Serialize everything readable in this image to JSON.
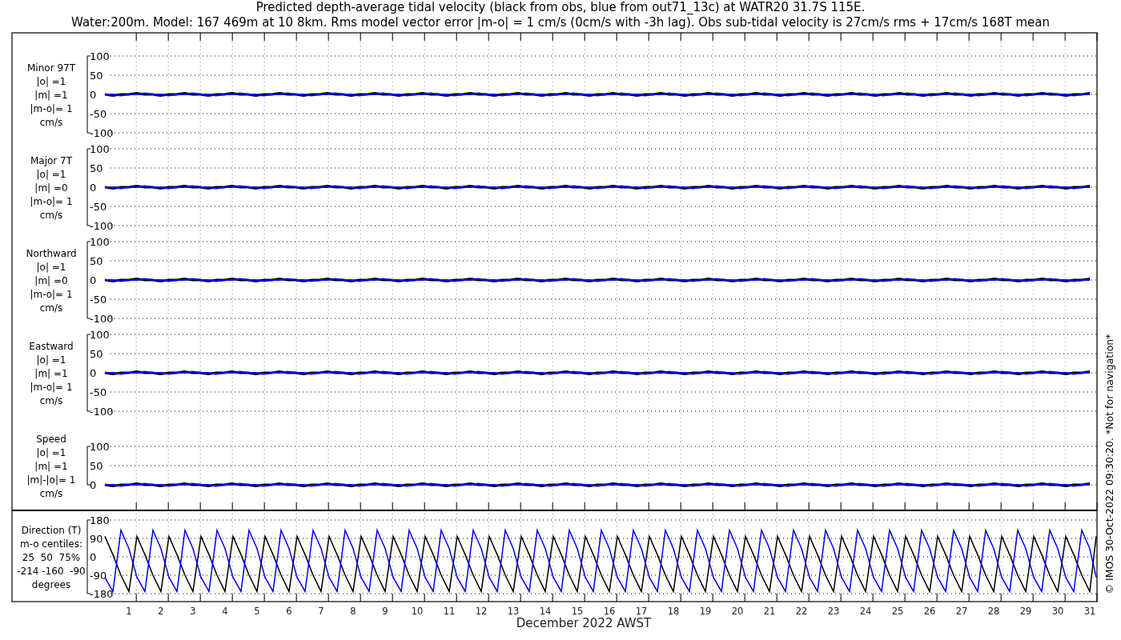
{
  "title_lines": [
    "Predicted depth-average tidal velocity (black from obs, blue from out71_13c) at WATR20 31.7S 115E.",
    "Water:200m. Model: 167 469m at 10 8km. Rms model vector error |m-o| = 1 cm/s (0cm/s with -3h lag). Obs sub-tidal velocity is 27cm/s rms + 17cm/s 168T mean"
  ],
  "panels": [
    {
      "kind": "velocity",
      "label_lines": [
        "Minor 97T",
        "|o| =1",
        "|m| =1",
        "|m-o|= 1",
        "cm/s"
      ],
      "y_ticks": [
        "100",
        "50",
        "0",
        "-50",
        "-100"
      ]
    },
    {
      "kind": "velocity",
      "label_lines": [
        "Major 7T",
        "|o| =1",
        "|m| =0",
        "|m-o|= 1",
        "cm/s"
      ],
      "y_ticks": [
        "100",
        "50",
        "0",
        "-50",
        "-100"
      ]
    },
    {
      "kind": "velocity",
      "label_lines": [
        "Northward",
        "|o| =1",
        "|m| =0",
        "|m-o|= 1",
        "cm/s"
      ],
      "y_ticks": [
        "100",
        "50",
        "0",
        "-50",
        "-100"
      ]
    },
    {
      "kind": "velocity",
      "label_lines": [
        "Eastward",
        "|o| =1",
        "|m| =1",
        "|m-o|= 1",
        "cm/s"
      ],
      "y_ticks": [
        "100",
        "50",
        "0",
        "-50",
        "-100"
      ]
    },
    {
      "kind": "velocity",
      "label_lines": [
        "Speed",
        "|o| =1",
        "|m| =1",
        "|m|-|o|= 1",
        "cm/s"
      ],
      "y_ticks": [
        "100",
        "50",
        "0"
      ]
    },
    {
      "kind": "direction",
      "label_lines": [
        "Direction (T)",
        "m-o centiles:",
        "25  50  75%",
        "-214 -160  -90",
        "degrees"
      ],
      "chart_data": {
        "type": "line",
        "xlabel": "December 2022 AWST",
        "xlim": [
          -2.65,
          31.22
        ],
        "grid": true,
        "ylim": [
          -180,
          180
        ],
        "yticks": [
          -180,
          -90,
          0,
          90,
          180
        ],
        "xticks": [
          1,
          2,
          3,
          4,
          5,
          6,
          7,
          8,
          9,
          10,
          11,
          12,
          13,
          14,
          15,
          16,
          17,
          18,
          19,
          20,
          21,
          22,
          23,
          24,
          25,
          26,
          27,
          28,
          29,
          30,
          31
        ],
        "x": [
          0.25,
          0.5,
          0.75,
          1,
          1.25,
          1.5,
          1.75,
          2,
          2.25,
          2.5,
          2.75,
          3,
          3.25,
          3.5,
          3.75,
          4,
          4.25,
          4.5,
          4.75,
          5,
          5.25,
          5.5,
          5.75,
          6,
          6.25,
          6.5,
          6.75,
          7,
          7.25,
          7.5,
          7.75,
          8,
          8.25,
          8.5,
          8.75,
          9,
          9.25,
          9.5,
          9.75,
          10,
          10.25,
          10.5,
          10.75,
          11,
          11.25,
          11.5,
          11.75,
          12,
          12.25,
          12.5,
          12.75,
          13,
          13.25,
          13.5,
          13.75,
          14,
          14.25,
          14.5,
          14.75,
          15,
          15.25,
          15.5,
          15.75,
          16,
          16.25,
          16.5,
          16.75,
          17,
          17.25,
          17.5,
          17.75,
          18,
          18.25,
          18.5,
          18.75,
          19,
          19.25,
          19.5,
          19.75,
          20,
          20.25,
          20.5,
          20.75,
          21,
          21.25,
          21.5,
          21.75,
          22,
          22.25,
          22.5,
          22.75,
          23,
          23.25,
          23.5,
          23.75,
          24,
          24.25,
          24.5,
          24.75,
          25,
          25.25,
          25.5,
          25.75,
          26,
          26.25,
          26.5,
          26.75,
          27,
          27.25,
          27.5,
          27.75,
          28,
          28.25,
          28.5,
          28.75,
          29,
          29.25,
          29.5,
          29.75,
          30,
          30.25,
          30.5,
          30.75,
          31,
          31.2
        ],
        "series": [
          {
            "color": "#000000",
            "values": [
              100,
              10,
              -90,
              -170,
              100,
              10,
              -90,
              -170,
              100,
              10,
              -90,
              -170,
              100,
              10,
              -90,
              -170,
              100,
              10,
              -90,
              -170,
              100,
              10,
              -90,
              -170,
              100,
              10,
              -90,
              -170,
              100,
              10,
              -90,
              -170,
              100,
              10,
              -90,
              -170,
              100,
              10,
              -90,
              -170,
              100,
              10,
              -90,
              -170,
              100,
              10,
              -90,
              -170,
              100,
              10,
              -90,
              -170,
              100,
              10,
              -90,
              -170,
              100,
              10,
              -90,
              -170,
              100,
              10,
              -90,
              -170,
              100,
              10,
              -90,
              -170,
              100,
              10,
              -90,
              -170,
              100,
              10,
              -90,
              -170,
              100,
              10,
              -90,
              -170,
              100,
              10,
              -90,
              -170,
              100,
              10,
              -90,
              -170,
              100,
              10,
              -90,
              -170,
              100,
              10,
              -90,
              -170,
              100,
              10,
              -90,
              -170,
              100,
              10,
              -90,
              -170,
              100,
              10,
              -90,
              -170,
              100,
              10,
              -90,
              -170,
              100,
              10,
              -90,
              -170,
              100,
              10,
              -90,
              -170,
              100,
              10,
              -90,
              -170,
              100
            ]
          },
          {
            "color": "#0000ff",
            "values": [
              -100,
              -170,
              130,
              40,
              -100,
              -170,
              130,
              40,
              -100,
              -170,
              130,
              40,
              -100,
              -170,
              130,
              40,
              -100,
              -170,
              130,
              40,
              -100,
              -170,
              130,
              40,
              -100,
              -170,
              130,
              40,
              -100,
              -170,
              130,
              40,
              -100,
              -170,
              130,
              40,
              -100,
              -170,
              130,
              40,
              -100,
              -170,
              130,
              40,
              -100,
              -170,
              130,
              40,
              -100,
              -170,
              130,
              40,
              -100,
              -170,
              130,
              40,
              -100,
              -170,
              130,
              40,
              -100,
              -170,
              130,
              40,
              -100,
              -170,
              130,
              40,
              -100,
              -170,
              130,
              40,
              -100,
              -170,
              130,
              40,
              -100,
              -170,
              130,
              40,
              -100,
              -170,
              130,
              40,
              -100,
              -170,
              130,
              40,
              -100,
              -170,
              130,
              40,
              -100,
              -170,
              130,
              40,
              -100,
              -170,
              130,
              40,
              -100,
              -170,
              130,
              40,
              -100,
              -170,
              130,
              40,
              -100,
              -170,
              130,
              40,
              -100,
              -170,
              130,
              40,
              -100,
              -170,
              130,
              40,
              -100,
              -170,
              130,
              40,
              -100
            ]
          }
        ]
      }
    }
  ],
  "copyright": "© IMOS 30-Oct-2022 09:30:20. *Not for navigation*"
}
